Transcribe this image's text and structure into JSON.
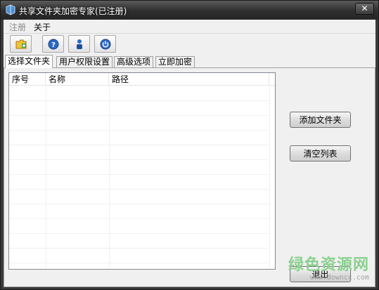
{
  "window": {
    "title": "共享文件夹加密专家(已注册)",
    "close_glyph": "✕"
  },
  "menu": {
    "items": [
      {
        "label": "注册",
        "disabled": true
      },
      {
        "label": "关于",
        "disabled": false
      }
    ]
  },
  "toolbar": {
    "buttons": [
      {
        "icon": "add-folder-icon"
      },
      {
        "icon": "help-icon"
      },
      {
        "icon": "user-icon"
      },
      {
        "icon": "power-icon"
      }
    ]
  },
  "tabs": [
    {
      "label": "选择文件夹",
      "active": true
    },
    {
      "label": "用户权限设置",
      "active": false
    },
    {
      "label": "高级选项",
      "active": false
    },
    {
      "label": "立即加密",
      "active": false
    }
  ],
  "folder_list": {
    "columns": [
      "序号",
      "名称",
      "路径"
    ],
    "rows": []
  },
  "buttons": {
    "add_folder": "添加文件夹",
    "clear_list": "清空列表",
    "exit": "退出"
  },
  "watermark": {
    "text": "绿色资源网",
    "url": "www.downcc.com"
  },
  "colors": {
    "title_bar": "#2e2e2e",
    "client_bg": "#f0f0f0",
    "watermark": "#8bd08f"
  }
}
